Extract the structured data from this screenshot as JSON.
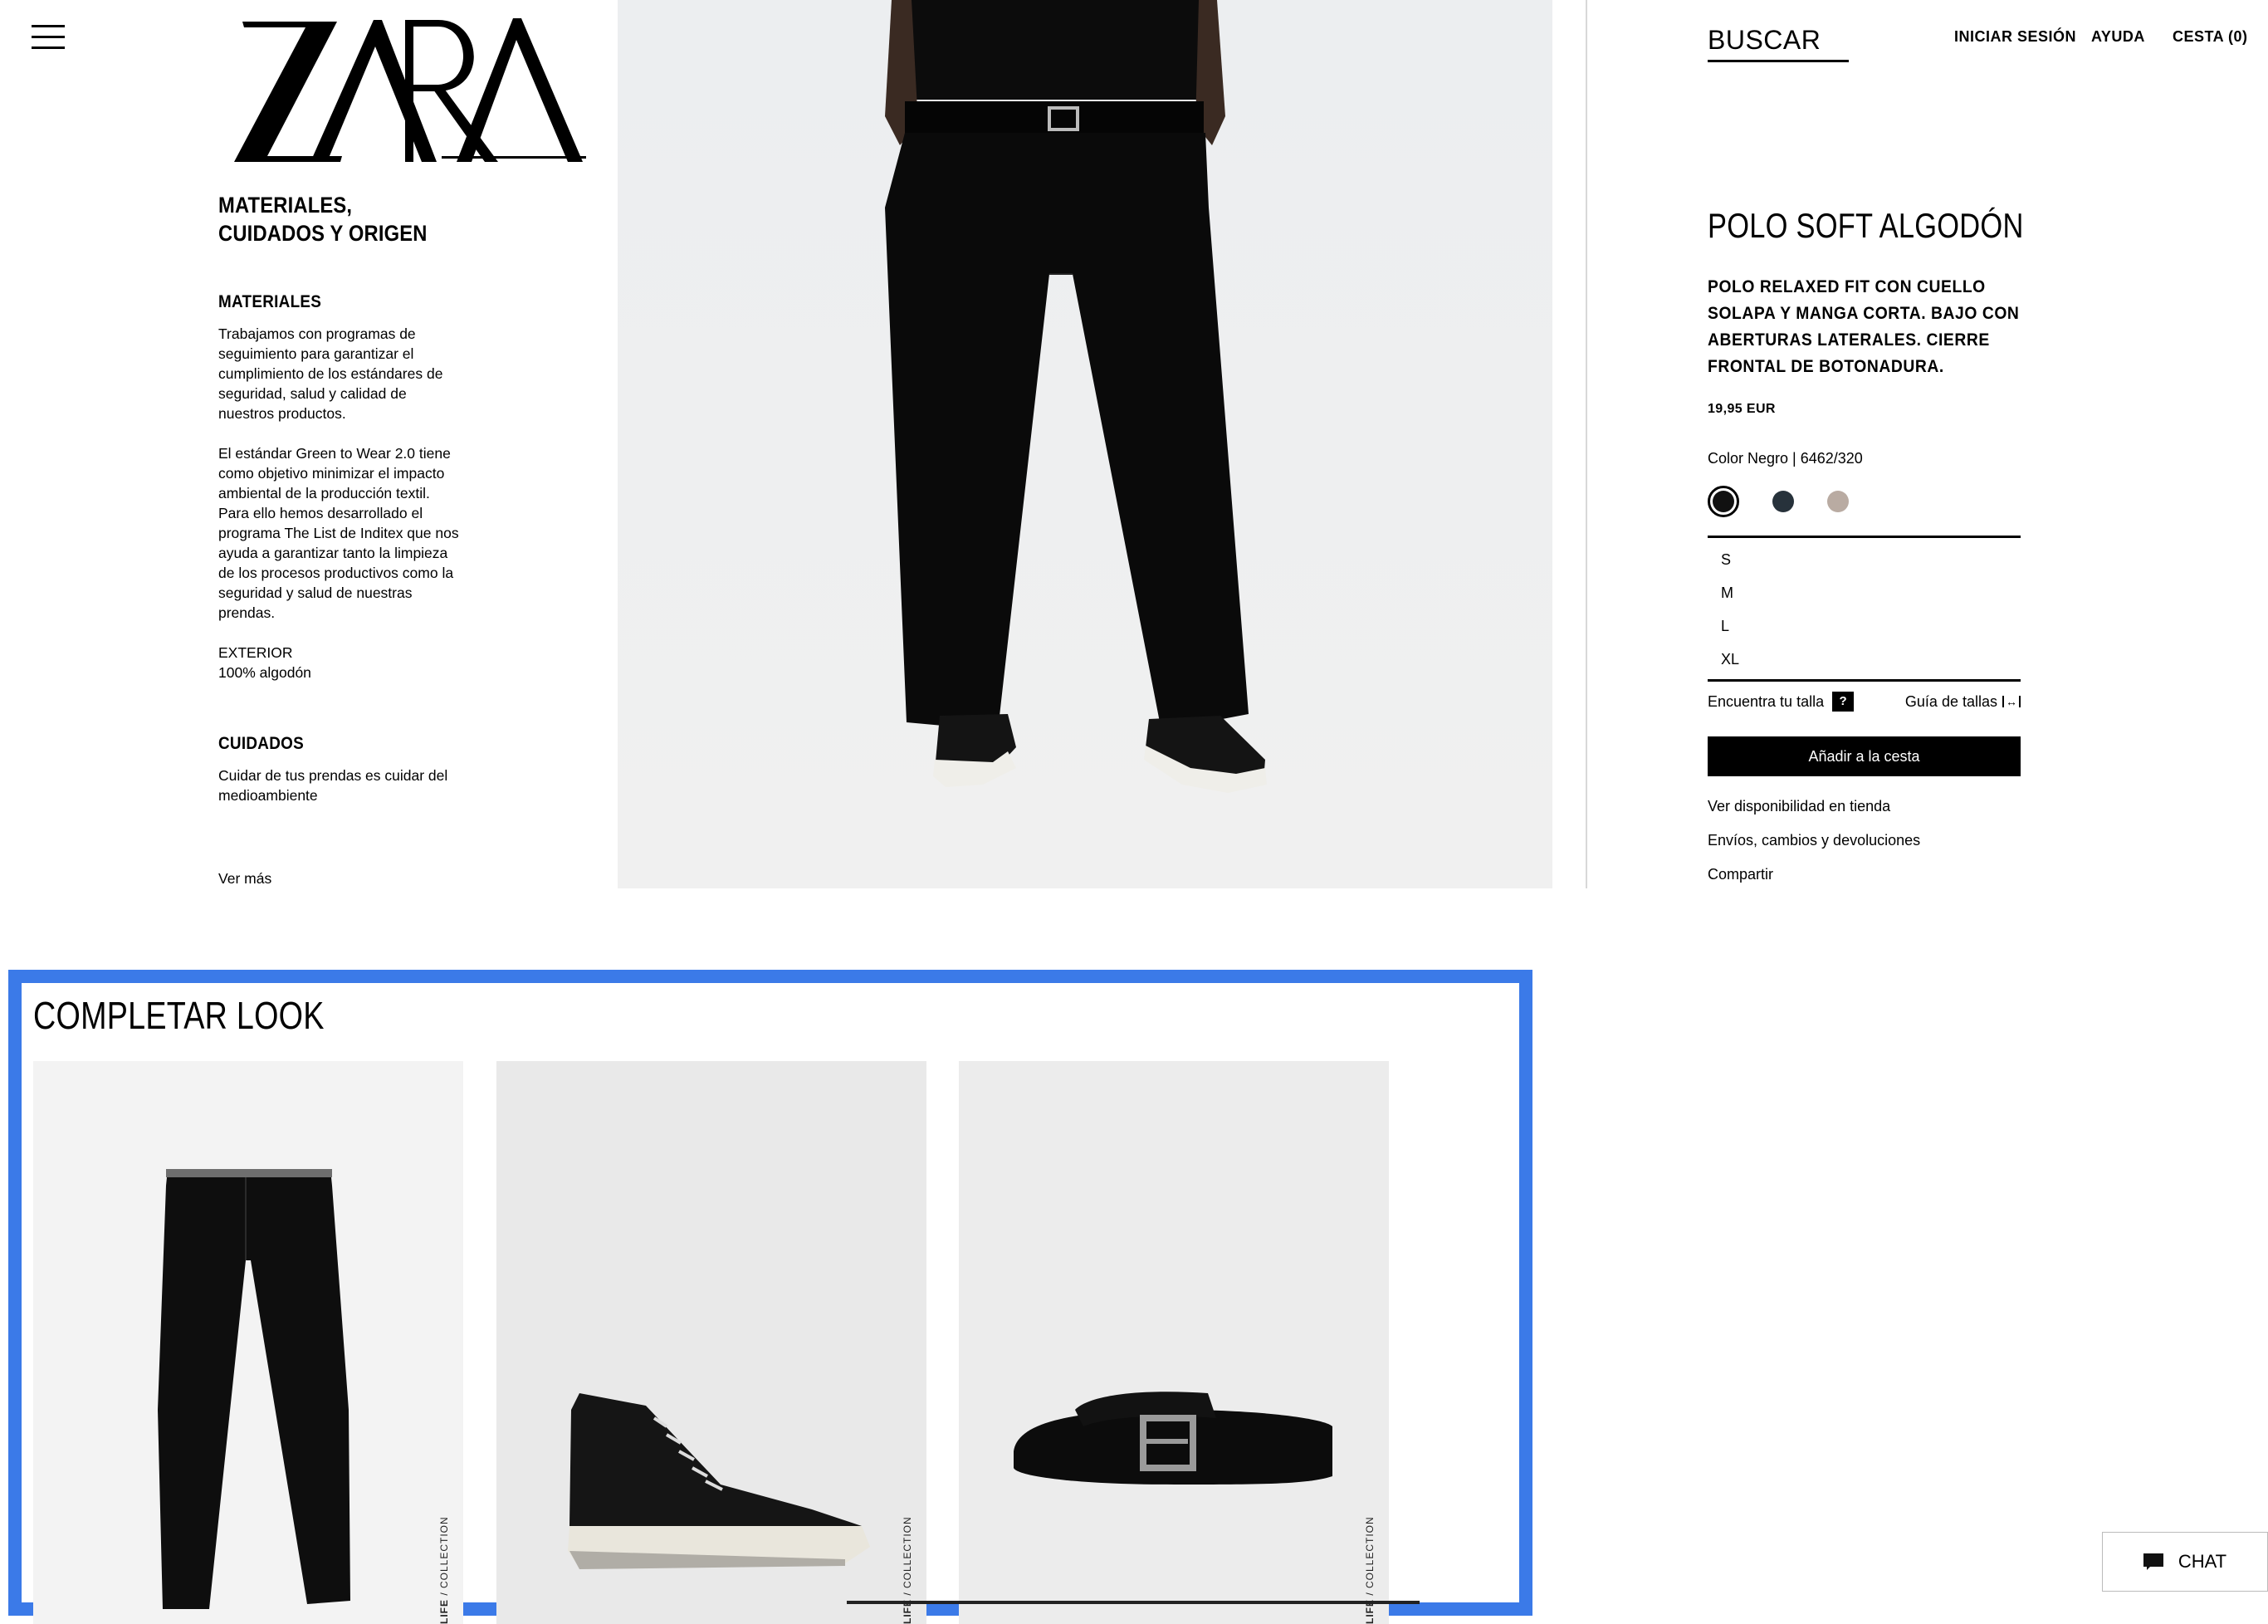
{
  "header": {
    "brand": "ZARA",
    "search_label": "BUSCAR",
    "login_label": "INICIAR SESIÓN",
    "help_label": "AYUDA",
    "cart_label": "CESTA (0)"
  },
  "info": {
    "title": "MATERIALES, CUIDADOS Y ORIGEN",
    "materials_heading": "MATERIALES",
    "materials_p1": "Trabajamos con programas de seguimiento para garantizar el cumplimiento de los estándares de seguridad, salud y calidad de nuestros productos.",
    "materials_p2": "El estándar Green to Wear 2.0 tiene como objetivo minimizar el impacto ambiental de la producción textil. Para ello hemos desarrollado el programa The List de Inditex que nos ayuda a garantizar tanto la limpieza de los procesos productivos como la seguridad y salud de nuestras prendas.",
    "exterior_label": "EXTERIOR",
    "exterior_value": "100% algodón",
    "care_heading": "CUIDADOS",
    "care_text": "Cuidar de tus prendas es cuidar del medioambiente",
    "more_label": "Ver más"
  },
  "product": {
    "name": "POLO SOFT ALGODÓN",
    "description": "POLO RELAXED FIT CON CUELLO SOLAPA Y MANGA CORTA. BAJO CON ABERTURAS LATERALES. CIERRE FRONTAL DE BOTONADURA.",
    "price": "19,95 EUR",
    "color_line": "Color Negro | 6462/320",
    "swatches": [
      {
        "name": "Negro",
        "hex": "#111111",
        "selected": true
      },
      {
        "name": "Azul marino",
        "hex": "#27323b",
        "selected": false
      },
      {
        "name": "Beige",
        "hex": "#b9aba2",
        "selected": false
      }
    ],
    "sizes": [
      "S",
      "M",
      "L",
      "XL"
    ],
    "find_size_label": "Encuentra tu talla",
    "find_size_icon": "?",
    "size_guide_label": "Guía de tallas",
    "add_to_cart_label": "Añadir a la cesta",
    "store_availability_label": "Ver disponibilidad en tienda",
    "shipping_label": "Envíos, cambios y devoluciones",
    "share_label": "Compartir"
  },
  "look": {
    "title": "COMPLETAR LOOK",
    "cards": [
      {
        "item": "pantalón",
        "label_bold": "LIFE",
        "label_rest": " / COLLECTION"
      },
      {
        "item": "zapatilla",
        "label_bold": "LIFE",
        "label_rest": " / COLLECTION"
      },
      {
        "item": "cinturón",
        "label_bold": "LIFE",
        "label_rest": " / COLLECTION"
      }
    ]
  },
  "chat": {
    "label": "CHAT"
  },
  "colors": {
    "accent_frame": "#3b7ae8",
    "button_bg": "#000000"
  }
}
